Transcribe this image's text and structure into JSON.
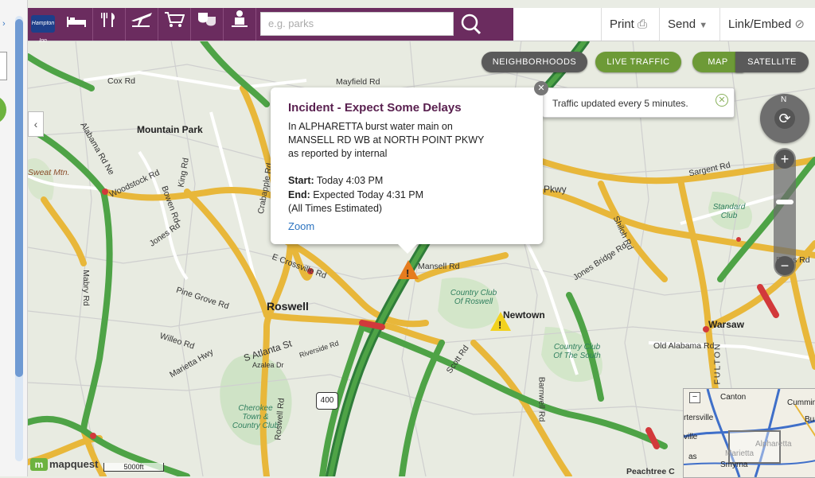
{
  "toolbar": {
    "logo_text": "Hampton Inn",
    "categories": [
      {
        "icon": "bed-icon",
        "glyph": "🛏"
      },
      {
        "icon": "dining-icon",
        "glyph": "🍴"
      },
      {
        "icon": "travel-icon",
        "glyph": "✈"
      },
      {
        "icon": "shopping-cart-icon",
        "glyph": "🛒"
      },
      {
        "icon": "entertainment-icon",
        "glyph": "🎭"
      },
      {
        "icon": "person-icon",
        "glyph": "👤"
      }
    ],
    "search_placeholder": "e.g. parks",
    "print_label": "Print",
    "send_label": "Send",
    "link_label": "Link/Embed"
  },
  "layers": {
    "neighborhoods": "NEIGHBORHOODS",
    "live_traffic": "LIVE TRAFFIC",
    "map": "MAP",
    "satellite": "SATELLITE"
  },
  "traffic_tooltip": "Traffic updated every 5 minutes.",
  "incident": {
    "title": "Incident - Expect Some Delays",
    "desc1": "In ALPHARETTA burst water main on",
    "desc2": "MANSELL RD WB at NORTH POINT PKWY",
    "desc3": "as reported by internal",
    "start_label": "Start:",
    "start_value": "Today 4:03 PM",
    "end_label": "End:",
    "end_value": "Expected Today 4:31 PM",
    "note": "(All Times Estimated)",
    "zoom_label": "Zoom"
  },
  "compass_n": "N",
  "places": {
    "mountain_park": "Mountain Park",
    "roswell": "Roswell",
    "newtown": "Newtown",
    "warsaw": "Warsaw",
    "sweat_mtn": "Sweat Mtn.",
    "country_club_roswell": "Country Club Of Roswell",
    "country_club_south": "Country Club Of The South",
    "standard_club": "Standard Club",
    "cherokee": "Cherokee Town & Country Club"
  },
  "roads": {
    "cox": "Cox Rd",
    "mayfield": "Mayfield Rd",
    "woodstock": "Woodstock Rd",
    "alabama": "Alabama Rd Ne",
    "bowen": "Bowen Rd",
    "jones": "Jones Rd",
    "king": "King Rd",
    "crabapple": "Crabapple Rd",
    "crossville": "E Crossville Rd",
    "mansell": "Mansell Rd",
    "pinegrove": "Pine Grove Rd",
    "willeo": "Willeo Rd",
    "marietta": "Marietta Hwy",
    "atlanta": "S Atlanta St",
    "azalea": "Azalea Dr",
    "riverside": "Riverside Rd",
    "scott": "Scott Rd",
    "barnwell": "Barnwell Rd",
    "oldalabama": "Old Alabama Rd",
    "sargent": "Sargent Rd",
    "jonesbridge": "Jones Bridge Rd",
    "shiloh": "Shiloh Rd",
    "boles": "Boles Rd",
    "mabry": "Mabry Rd",
    "pkwy": "Pkwy",
    "roswellrd": "Roswell Rd",
    "peachtree": "Peachtree C",
    "fulton": "FULTON",
    "hwy400": "400"
  },
  "minimap": {
    "canton": "Canton",
    "cumming": "Cummin",
    "cartersville": "rtersville",
    "alpharetta": "Alpharetta",
    "marietta": "Marietta",
    "smyrna": "Smyrna",
    "buf": "Bu",
    "ville": "ville",
    "as": "as"
  },
  "scale_label": "5000ft",
  "brand": "mapquest"
}
